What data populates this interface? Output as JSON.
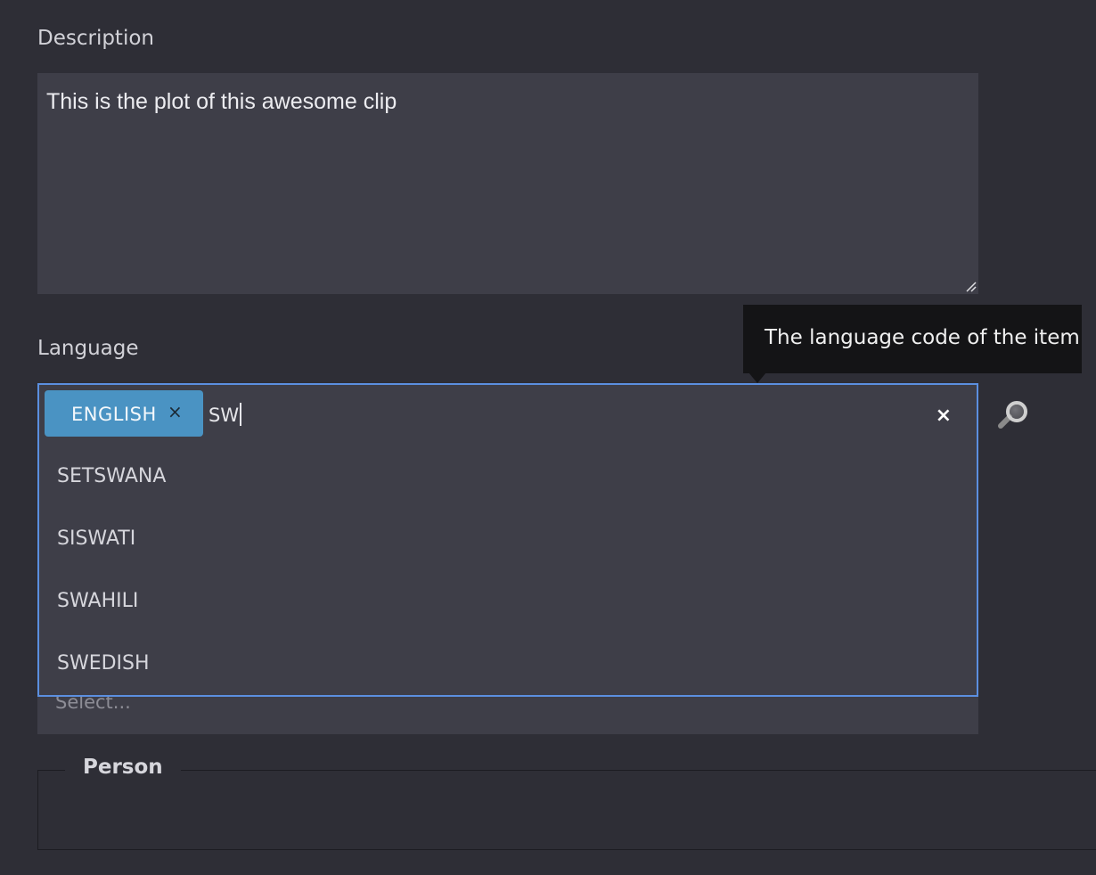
{
  "description": {
    "label": "Description",
    "value": "This is the plot of this awesome clip"
  },
  "language": {
    "label": "Language",
    "tooltip": "The language code of the item",
    "selected_tags": [
      {
        "label": "ENGLISH",
        "remove_symbol": "×"
      }
    ],
    "search_value": "SW",
    "clear_symbol": "×",
    "options": [
      "SETSWANA",
      "SISWATI",
      "SWAHILI",
      "SWEDISH"
    ],
    "placeholder": "Select...",
    "search_icon": "magnifier-icon"
  },
  "person": {
    "legend": "Person"
  },
  "colors": {
    "background": "#2e2e36",
    "field_bg": "#3e3e48",
    "focus_border": "#5b8fe0",
    "tag_bg": "#4a93c3",
    "tooltip_bg": "#141416"
  }
}
